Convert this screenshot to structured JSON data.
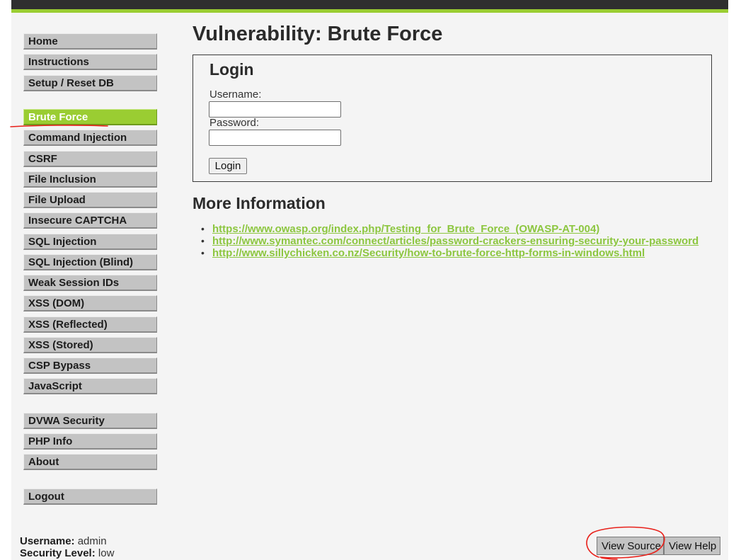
{
  "page": {
    "title": "Vulnerability: Brute Force"
  },
  "colors": {
    "accent": "#9acd32",
    "link": "#8cc63f",
    "topbar": "#2f2f2f",
    "annotation": "#e8201a"
  },
  "menu": {
    "group1": [
      "Home",
      "Instructions",
      "Setup / Reset DB"
    ],
    "group2": [
      "Brute Force",
      "Command Injection",
      "CSRF",
      "File Inclusion",
      "File Upload",
      "Insecure CAPTCHA",
      "SQL Injection",
      "SQL Injection (Blind)",
      "Weak Session IDs",
      "XSS (DOM)",
      "XSS (Reflected)",
      "XSS (Stored)",
      "CSP Bypass",
      "JavaScript"
    ],
    "group3": [
      "DVWA Security",
      "PHP Info",
      "About"
    ],
    "group4": [
      "Logout"
    ],
    "active_item": "Brute Force"
  },
  "login": {
    "heading": "Login",
    "username_label": "Username:",
    "username_value": "",
    "password_label": "Password:",
    "password_value": "",
    "button_label": "Login"
  },
  "more_info": {
    "heading": "More Information",
    "links": [
      "https://www.owasp.org/index.php/Testing_for_Brute_Force_(OWASP-AT-004)",
      "http://www.symantec.com/connect/articles/password-crackers-ensuring-security-your-password",
      "http://www.sillychicken.co.nz/Security/how-to-brute-force-http-forms-in-windows.html"
    ]
  },
  "footer": {
    "username_label": "Username:",
    "username_value": "admin",
    "security_label": "Security Level:",
    "security_value": "low",
    "view_source_label": "View Source",
    "view_help_label": "View Help"
  },
  "annotations": [
    "red-underline-brute-force",
    "red-circle-view-source"
  ]
}
